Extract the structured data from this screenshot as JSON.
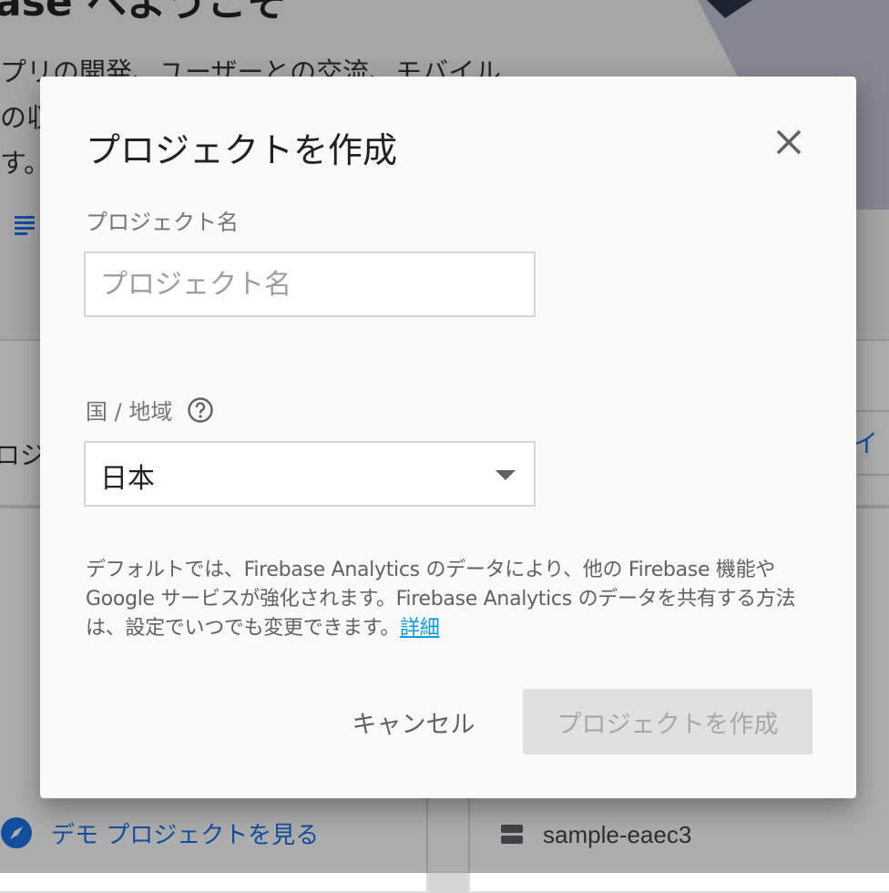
{
  "background": {
    "hero_title": "ase へようこそ",
    "hero_text_line1": "プリの開発、ユーザーとの交流、モバイル",
    "hero_text_line2": "の収",
    "hero_text_line3": "す。",
    "project_section_text": "ロジ",
    "right_tab_text": "イン",
    "demo_link": "デモ プロジェクトを見る",
    "sample_project": "sample-eaec3",
    "colors": {
      "link": "#1a73e8"
    }
  },
  "dialog": {
    "title": "プロジェクトを作成",
    "close_icon": "close-icon",
    "project_name": {
      "label": "プロジェクト名",
      "placeholder": "プロジェクト名",
      "value": ""
    },
    "country": {
      "label": "国 / 地域",
      "help_icon": "help-circle-icon",
      "selected": "日本"
    },
    "notice": {
      "text": "デフォルトでは、Firebase Analytics のデータにより、他の Firebase 機能や Google サービスが強化されます。Firebase Analytics のデータを共有する方法は、設定でいつでも変更できます。",
      "link": "詳細"
    },
    "buttons": {
      "cancel": "キャンセル",
      "create": "プロジェクトを作成"
    },
    "colors": {
      "link": "#039be5",
      "disabled_bg": "#e0e0e0",
      "disabled_text": "#a8a8a8"
    }
  }
}
